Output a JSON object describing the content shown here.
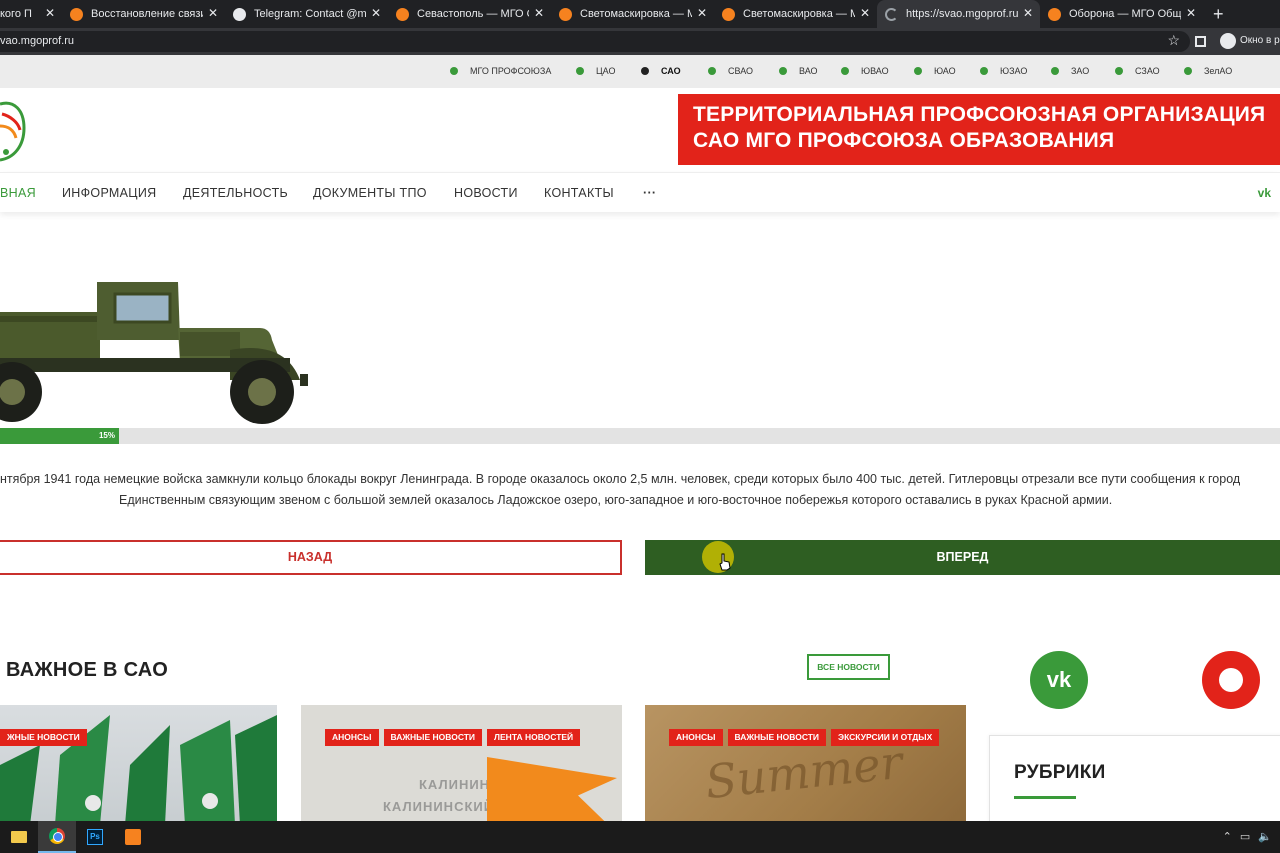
{
  "browser": {
    "tabs": [
      {
        "label": "кого П",
        "icon": "site-icon"
      },
      {
        "label": "Восстановление связи —",
        "icon": "site-icon"
      },
      {
        "label": "Telegram: Contact @mgop",
        "icon": "globe-icon"
      },
      {
        "label": "Севастополь — МГО Об",
        "icon": "site-icon"
      },
      {
        "label": "Светомаскировка — МГ",
        "icon": "site-icon"
      },
      {
        "label": "Светомаскировка — МГ",
        "icon": "site-icon"
      },
      {
        "label": "https://svao.mgoprof.ru",
        "icon": "loading-icon"
      },
      {
        "label": "Оборона — МГО Общер",
        "icon": "site-icon"
      }
    ],
    "url": "vao.mgoprof.ru",
    "incognito_label": "Окно в р"
  },
  "regions": [
    {
      "label": "МГО ПРОФСОЮЗА",
      "active": false
    },
    {
      "label": "ЦАО",
      "active": false
    },
    {
      "label": "САО",
      "active": true
    },
    {
      "label": "СВАО",
      "active": false
    },
    {
      "label": "ВАО",
      "active": false
    },
    {
      "label": "ЮВАО",
      "active": false
    },
    {
      "label": "ЮАО",
      "active": false
    },
    {
      "label": "ЮЗАО",
      "active": false
    },
    {
      "label": "ЗАО",
      "active": false
    },
    {
      "label": "СЗАО",
      "active": false
    },
    {
      "label": "ЗелАО",
      "active": false
    }
  ],
  "header": {
    "banner_line1": "ТЕРРИТОРИАЛЬНАЯ ПРОФСОЮЗНАЯ ОРГАНИЗАЦИЯ",
    "banner_line2": "САО МГО ПРОФСОЮЗА ОБРАЗОВАНИЯ"
  },
  "nav": {
    "home": "ВНАЯ",
    "info": "ИНФОРМАЦИЯ",
    "activity": "ДЕЯТЕЛЬНОСТЬ",
    "docs": "ДОКУМЕНТЫ ТПО",
    "news": "НОВОСТИ",
    "contacts": "КОНТАКТЫ",
    "more": "···",
    "vk": "vk"
  },
  "slider": {
    "progress_percent": 15,
    "progress_label": "15%",
    "text_line1": "нтября 1941 года немецкие войска замкнули кольцо блокады вокруг Ленинграда. В городе оказалось около 2,5 млн. человек, среди которых было 400 тыс. детей. Гитлеровцы отрезали все пути сообщения к город",
    "text_line2": "Единственным связующим звеном с большой землей оказалось Ладожское озеро, юго-западное и юго-восточное побережья которого оставались в руках Красной армии.",
    "back_label": "НАЗАД",
    "forward_label": "ВПЕРЕД"
  },
  "important": {
    "title": "ВАЖНОЕ В САО",
    "all_news_label": "ВСЕ НОВОСТИ",
    "cards": [
      {
        "tags": [
          "ЖНЫЕ НОВОСТИ"
        ]
      },
      {
        "tags": [
          "АНОНСЫ",
          "ВАЖНЫЕ НОВОСТИ",
          "ЛЕНТА НОВОСТЕЙ"
        ],
        "map_text": [
          "КАЛИНИН",
          "КАЛИНИНСКИЙ ФРОНТ"
        ]
      },
      {
        "tags": [
          "АНОНСЫ",
          "ВАЖНЫЕ НОВОСТИ",
          "ЭКСКУРСИИ И ОТДЫХ"
        ],
        "image_text": "Summer"
      }
    ]
  },
  "sidebar": {
    "vk_label": "vk",
    "rubrics_title": "РУБРИКИ"
  },
  "colors": {
    "green": "#3a9a3a",
    "dark_green": "#2e5e22",
    "red": "#e2231a"
  }
}
